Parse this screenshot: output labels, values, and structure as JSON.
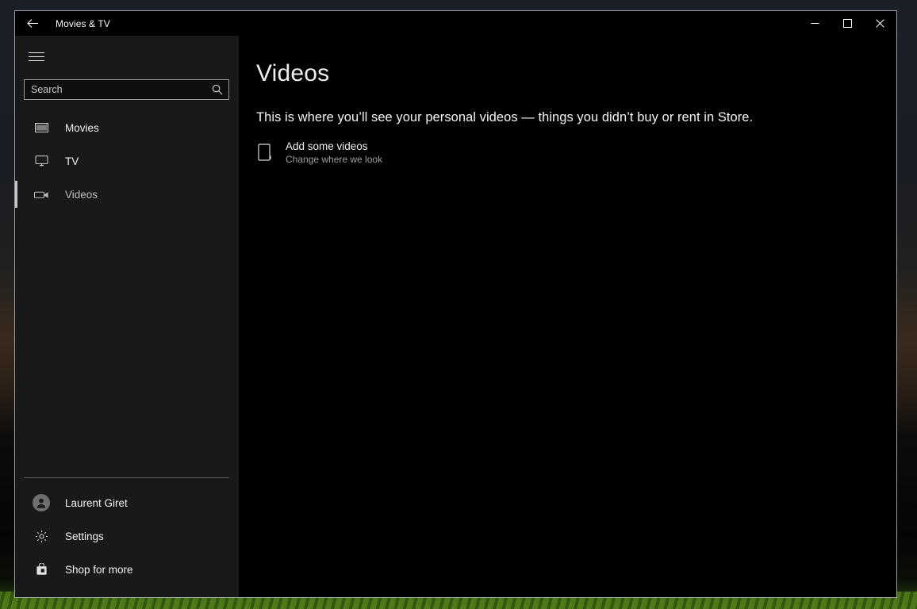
{
  "window": {
    "title": "Movies & TV",
    "back_icon": "back-arrow-icon",
    "controls": {
      "minimize": "minimize-icon",
      "maximize": "maximize-icon",
      "close": "close-icon"
    }
  },
  "sidebar": {
    "menu_icon": "hamburger-menu-icon",
    "search": {
      "placeholder": "Search",
      "value": "",
      "icon": "search-icon"
    },
    "nav_items": [
      {
        "label": "Movies",
        "icon": "film-strip-icon",
        "selected": false
      },
      {
        "label": "TV",
        "icon": "monitor-icon",
        "selected": false
      },
      {
        "label": "Videos",
        "icon": "video-camera-icon",
        "selected": true
      }
    ],
    "bottom_items": [
      {
        "label": "Laurent Giret",
        "icon": "account-avatar-icon"
      },
      {
        "label": "Settings",
        "icon": "gear-icon"
      },
      {
        "label": "Shop for more",
        "icon": "store-bag-icon"
      }
    ]
  },
  "main": {
    "page_title": "Videos",
    "empty_message": "This is where you’ll see your personal videos — things you didn’t buy or rent in Store.",
    "add_action": {
      "title": "Add some videos",
      "subtitle": "Change where we look",
      "icon": "add-folder-icon"
    }
  },
  "colors": {
    "window_background": "#000000",
    "sidebar_background": "#191919",
    "window_border": "#9aa0a6",
    "selection_bar": "#c6c6c6",
    "text_primary": "#f2f2f2",
    "text_secondary": "#9f9f9f"
  }
}
